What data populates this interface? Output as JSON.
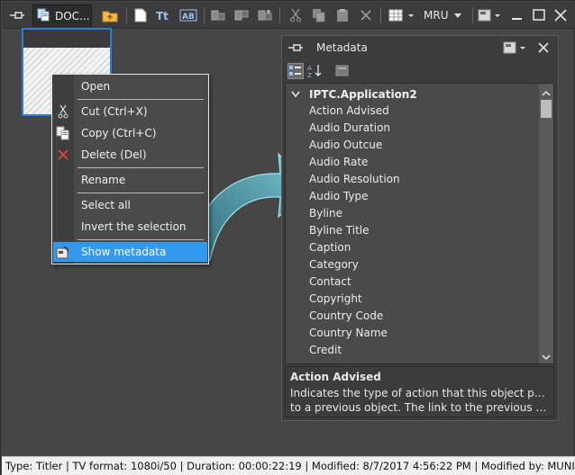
{
  "toolbar": {
    "doc_tab_label": "DOC...",
    "mru_label": "MRU"
  },
  "context_menu": {
    "items": [
      {
        "label": "Open"
      },
      {
        "label": "Cut (Ctrl+X)"
      },
      {
        "label": "Copy (Ctrl+C)"
      },
      {
        "label": "Delete (Del)"
      },
      {
        "label": "Rename"
      },
      {
        "label": "Select all"
      },
      {
        "label": "Invert the selection"
      },
      {
        "label": "Show metadata"
      }
    ]
  },
  "metadata_panel": {
    "title": "Metadata",
    "group": "IPTC.Application2",
    "items": [
      "Action Advised",
      "Audio Duration",
      "Audio Outcue",
      "Audio Rate",
      "Audio Resolution",
      "Audio Type",
      "Byline",
      "Byline Title",
      "Caption",
      "Category",
      "Contact",
      "Copyright",
      "Country Code",
      "Country Name",
      "Credit"
    ],
    "description": {
      "title": "Action Advised",
      "line1": "Indicates the type of action that this object provides",
      "line2": "to a previous object. The link to the previous object..."
    }
  },
  "status_bar": {
    "text": "Type: Titler | TV format: 1080i/50 | Duration: 00:00:22:19 | Modified: 8/7/2017 4:56:22 PM | Modified by: MUNICH\\bondar"
  },
  "colors": {
    "background": "#464646",
    "selection_blue": "#3399ee",
    "thumbnail_border": "#2a7fd4",
    "arrow_teal": "#4fb3c8"
  }
}
